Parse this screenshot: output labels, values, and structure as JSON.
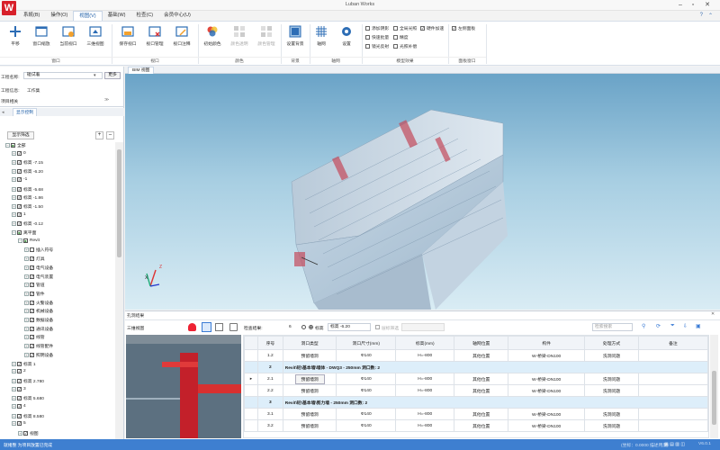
{
  "app": {
    "title": "Luban Works",
    "logo": "W"
  },
  "window": {
    "min": "–",
    "restore": "▫",
    "close": "✕"
  },
  "menu": [
    "系統(B)",
    "操作(O)",
    "视图(V)",
    "基础(W)",
    "检查(C)",
    "会员中心(U)"
  ],
  "menu_active": 2,
  "ribbon": {
    "buttons": [
      "平移",
      "窗口缩放",
      "当前视口",
      "三维视图",
      "保存视口",
      "视口管理",
      "视口注释",
      "初始颜色",
      "颜色透明",
      "颜色管理",
      "设置背景",
      "轴网",
      "设置"
    ],
    "groups": [
      "窗口",
      "视口",
      "颜色",
      "背景",
      "轴网",
      "模型效果",
      "面板窗口"
    ],
    "checks": [
      {
        "label": "添加阴影",
        "checked": false
      },
      {
        "label": "全局光照",
        "checked": false
      },
      {
        "label": "硬件加速",
        "checked": true
      },
      {
        "label": "快速批量",
        "checked": false
      },
      {
        "label": "精度",
        "checked": false
      },
      {
        "label": "镜光反射",
        "checked": false
      },
      {
        "label": "光照补偿",
        "checked": false
      },
      {
        "label": "左侧面板",
        "checked": true
      }
    ]
  },
  "left": {
    "project_name_label": "工程名称:",
    "project_name_value": "碰试着",
    "project_btn": "更多",
    "project_info_label": "工程信息:",
    "project_info_value": "工作集",
    "project_list_label": "项目相关",
    "tab": "显示控制",
    "filter_btn": "显示筛选",
    "plus": "+",
    "minus": "–",
    "tree": [
      {
        "d": 0,
        "t": "全部",
        "pm": "−",
        "cb": "■"
      },
      {
        "d": 1,
        "t": "0",
        "pm": "+",
        "cb": "✓"
      },
      {
        "d": 1,
        "t": "标高 -7.15",
        "pm": "+",
        "cb": "✓"
      },
      {
        "d": 1,
        "t": "标高 -6.20",
        "pm": "+",
        "cb": "✓"
      },
      {
        "d": 1,
        "t": "-1",
        "pm": "+",
        "cb": "✓"
      },
      {
        "d": 1,
        "t": "标高 -5.68",
        "pm": "+",
        "cb": "✓"
      },
      {
        "d": 1,
        "t": "标高 -1.86",
        "pm": "+",
        "cb": "✓"
      },
      {
        "d": 1,
        "t": "标高 -1.50",
        "pm": "+",
        "cb": "✓"
      },
      {
        "d": 1,
        "t": "1",
        "pm": "+",
        "cb": "✓"
      },
      {
        "d": 1,
        "t": "标高 -0.12",
        "pm": "+",
        "cb": "✓"
      },
      {
        "d": 1,
        "t": "离平面",
        "pm": "−",
        "cb": "■"
      },
      {
        "d": 2,
        "t": "Revit",
        "pm": "−",
        "cb": "■"
      },
      {
        "d": 3,
        "t": "插入符号",
        "pm": "+",
        "cb": ""
      },
      {
        "d": 3,
        "t": "灯具",
        "pm": "+",
        "cb": "✓"
      },
      {
        "d": 3,
        "t": "电气设备",
        "pm": "+",
        "cb": "✓"
      },
      {
        "d": 3,
        "t": "电气装置",
        "pm": "+",
        "cb": "✓"
      },
      {
        "d": 3,
        "t": "管道",
        "pm": "+",
        "cb": "✓"
      },
      {
        "d": 3,
        "t": "管件",
        "pm": "+",
        "cb": "✓"
      },
      {
        "d": 3,
        "t": "火警设备",
        "pm": "+",
        "cb": "✓"
      },
      {
        "d": 3,
        "t": "机械设备",
        "pm": "+",
        "cb": "✓"
      },
      {
        "d": 3,
        "t": "数据设备",
        "pm": "+",
        "cb": "✓"
      },
      {
        "d": 3,
        "t": "通讯设备",
        "pm": "+",
        "cb": "✓"
      },
      {
        "d": 3,
        "t": "线管",
        "pm": "+",
        "cb": "✓"
      },
      {
        "d": 3,
        "t": "线管配件",
        "pm": "+",
        "cb": "✓"
      },
      {
        "d": 3,
        "t": "照明设备",
        "pm": "+",
        "cb": "✓"
      },
      {
        "d": 1,
        "t": "标高 1",
        "pm": "+",
        "cb": "✓"
      },
      {
        "d": 1,
        "t": "2",
        "pm": "+",
        "cb": "✓"
      },
      {
        "d": 1,
        "t": "标高 2.780",
        "pm": "+",
        "cb": "✓"
      },
      {
        "d": 1,
        "t": "3",
        "pm": "+",
        "cb": "✓"
      },
      {
        "d": 1,
        "t": "标高 5.680",
        "pm": "+",
        "cb": "✓"
      },
      {
        "d": 1,
        "t": "4",
        "pm": "+",
        "cb": "✓"
      },
      {
        "d": 1,
        "t": "标高 8.580",
        "pm": "+",
        "cb": "✓"
      },
      {
        "d": 1,
        "t": "5",
        "pm": "+",
        "cb": "✓"
      },
      {
        "d": 2,
        "t": "视图",
        "pm": "+",
        "cb": "✓"
      }
    ]
  },
  "viewport": {
    "tab": "BIM 视图",
    "axis_z": "Z",
    "axis_x": "X"
  },
  "bottom": {
    "title": "孔洞结果",
    "view_label": "三维视图",
    "count_label": "检查结果:",
    "count_value": "6",
    "radio1": "标高",
    "radio2": "层标筛选",
    "level_value": "标高 -6.20",
    "search_placeholder": "检索搜索",
    "columns": [
      "序号",
      "洞口类型",
      "洞口尺寸(mm)",
      "标高(mm)",
      "轴网位置",
      "构件",
      "处理方式",
      "备注"
    ],
    "rows": [
      {
        "type": "row",
        "c": [
          "1.2",
          "预留墙洞",
          "Φ140",
          "H=-800",
          "其他位置",
          "W-桥梁-DN100",
          "洗洞问题",
          ""
        ],
        "btn": false
      },
      {
        "type": "group",
        "c": [
          "2",
          "Revit\\砼\\基本墙\\墙体 - DWQ3 - 250mm  洞口数: 2"
        ]
      },
      {
        "type": "row",
        "c": [
          "2.1",
          "预留墙洞",
          "Φ140",
          "H=-800",
          "其他位置",
          "W-桥梁-DN100",
          "洗洞问题",
          ""
        ],
        "btn": true
      },
      {
        "type": "row",
        "c": [
          "2.2",
          "预留墙洞",
          "Φ140",
          "H=-800",
          "其他位置",
          "W-桥梁-DN100",
          "洗洞问题",
          ""
        ],
        "btn": false
      },
      {
        "type": "group",
        "c": [
          "3",
          "Revit\\砼\\基本墙\\剪力墙 - 250mm  洞口数: 2"
        ]
      },
      {
        "type": "row",
        "c": [
          "3.1",
          "预留墙洞",
          "Φ140",
          "H=-800",
          "其他位置",
          "W-桥梁-DN100",
          "洗洞问题",
          ""
        ],
        "btn": false
      },
      {
        "type": "row",
        "c": [
          "3.2",
          "预留墙洞",
          "Φ140",
          "H=-800",
          "其他位置",
          "W-桥梁-DN100",
          "洗洞问题",
          ""
        ],
        "btn": false
      }
    ]
  },
  "status": {
    "left": "就绪整 为项目放置已完成",
    "right": "(坐标：0.0000  描述用度)",
    "version": "V6.0.1"
  }
}
